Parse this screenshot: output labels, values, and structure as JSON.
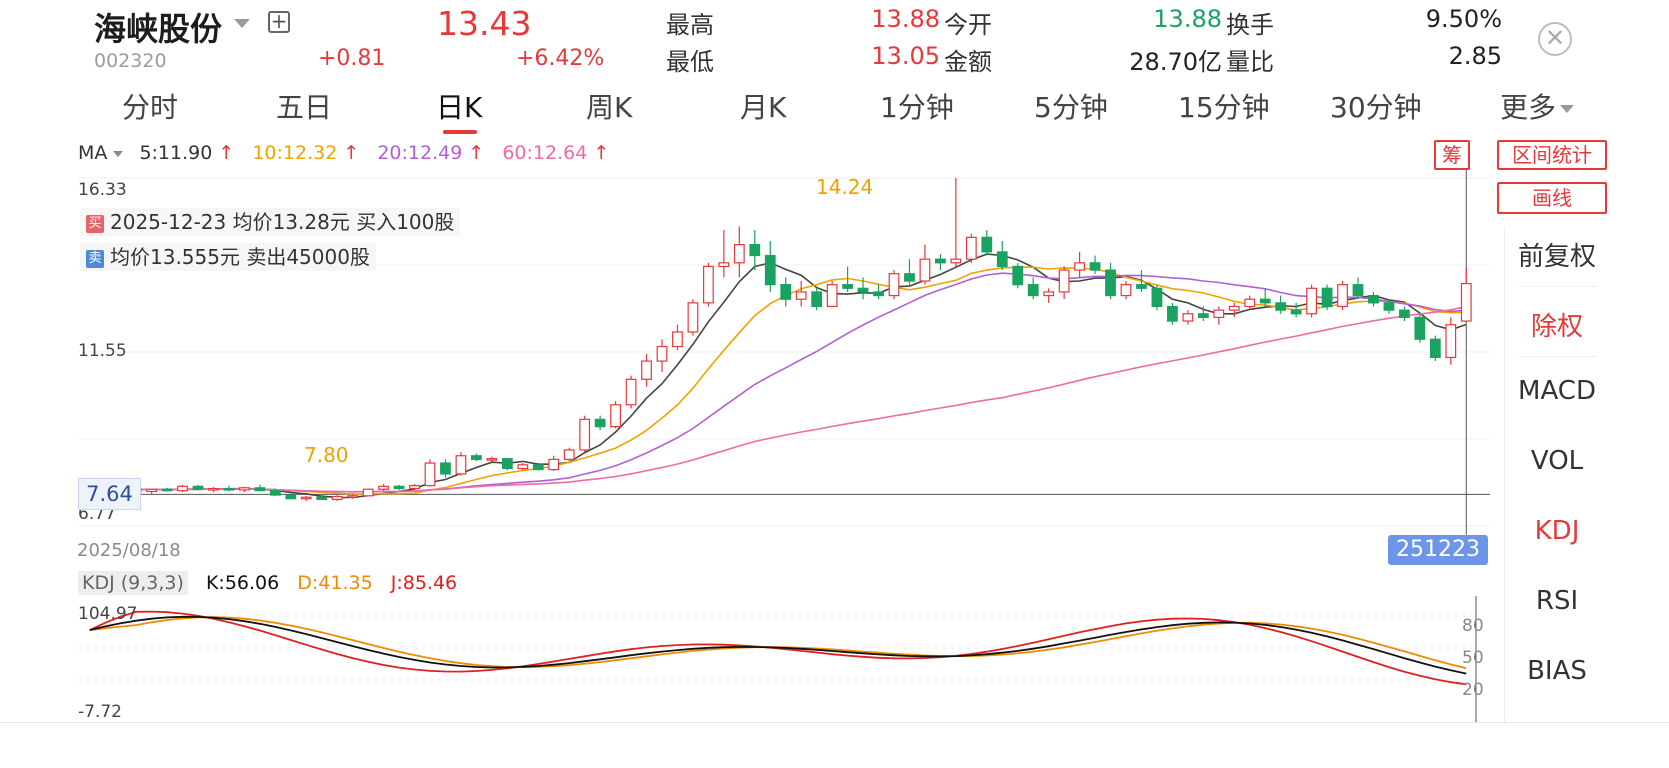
{
  "header": {
    "name": "海峡股份",
    "code": "002320",
    "price": "13.43",
    "change": "+0.81",
    "change_pct": "+6.42%",
    "quote": [
      {
        "label": "最高",
        "value": "13.88",
        "color": "#e8383a"
      },
      {
        "label": "今开",
        "value": "13.88",
        "color": "#1aa260"
      },
      {
        "label": "换手",
        "value": "9.50%",
        "color": "#222222"
      },
      {
        "label": "最低",
        "value": "13.05",
        "color": "#e8383a"
      },
      {
        "label": "金额",
        "value": "28.70亿",
        "color": "#222222"
      },
      {
        "label": "量比",
        "value": "2.85",
        "color": "#222222"
      }
    ]
  },
  "tabs": [
    "分时",
    "五日",
    "日K",
    "周K",
    "月K",
    "1分钟",
    "5分钟",
    "15分钟",
    "30分钟",
    "更多"
  ],
  "active_tab": "日K",
  "ma": {
    "label": "MA",
    "items": [
      {
        "text": "5:11.90",
        "color": "#333333"
      },
      {
        "text": "10:12.32",
        "color": "#f2a200"
      },
      {
        "text": "20:12.49",
        "color": "#b25fd6"
      },
      {
        "text": "60:12.64",
        "color": "#f06aa8"
      }
    ],
    "arrow": "↑",
    "arrow_color": "#e8383a"
  },
  "right_buttons": {
    "chips": "筹",
    "range_stats": "区间统计",
    "draw": "画线"
  },
  "side_panel": [
    {
      "label": "前复权",
      "active": false
    },
    {
      "label": "除权",
      "active": true
    },
    {
      "label": "MACD",
      "active": false
    },
    {
      "label": "VOL",
      "active": false
    },
    {
      "label": "KDJ",
      "active": true
    },
    {
      "label": "RSI",
      "active": false
    },
    {
      "label": "BIAS",
      "active": false
    }
  ],
  "trades": {
    "buy_tag": "买",
    "sell_tag": "卖",
    "buy_text": "2025-12-23 均价13.28元 买入100股",
    "sell_text": "均价13.555元 卖出45000股"
  },
  "axis": {
    "high": "16.33",
    "mid": "11.55",
    "low": "6.77",
    "current": "7.64"
  },
  "annotations": {
    "max": "14.24",
    "min": "7.80"
  },
  "dates": {
    "start": "2025/08/18",
    "cursor": "251223"
  },
  "kdj": {
    "name": "KDJ (9,3,3)",
    "k": "K:56.06",
    "d": "D:41.35",
    "j": "J:85.46",
    "top": "104.97",
    "bottom": "-7.72",
    "levels": [
      "80",
      "50",
      "20"
    ]
  },
  "colors": {
    "up": "#e8383a",
    "down": "#1aa260",
    "ma5": "#444444",
    "ma10": "#f2a200",
    "ma20": "#b25fd6",
    "ma60": "#f06aa8",
    "k": "#111111",
    "d": "#f08a00",
    "j": "#e02020"
  },
  "chart_data": {
    "type": "candlestick",
    "ylim": [
      6.77,
      16.33
    ],
    "candles": [
      [
        7.7,
        7.8,
        7.62,
        7.75
      ],
      [
        7.75,
        7.85,
        7.7,
        7.82
      ],
      [
        7.82,
        7.88,
        7.75,
        7.8
      ],
      [
        7.8,
        7.84,
        7.7,
        7.72
      ],
      [
        7.72,
        7.8,
        7.65,
        7.78
      ],
      [
        7.78,
        7.82,
        7.72,
        7.74
      ],
      [
        7.74,
        7.9,
        7.7,
        7.86
      ],
      [
        7.86,
        7.9,
        7.75,
        7.78
      ],
      [
        7.78,
        7.84,
        7.7,
        7.8
      ],
      [
        7.8,
        7.88,
        7.72,
        7.76
      ],
      [
        7.76,
        7.85,
        7.7,
        7.82
      ],
      [
        7.82,
        7.9,
        7.76,
        7.74
      ],
      [
        7.74,
        7.8,
        7.6,
        7.62
      ],
      [
        7.62,
        7.66,
        7.5,
        7.52
      ],
      [
        7.52,
        7.6,
        7.46,
        7.56
      ],
      [
        7.56,
        7.62,
        7.48,
        7.5
      ],
      [
        7.5,
        7.62,
        7.46,
        7.58
      ],
      [
        7.58,
        7.66,
        7.52,
        7.6
      ],
      [
        7.6,
        7.8,
        7.58,
        7.78
      ],
      [
        7.78,
        7.92,
        7.74,
        7.86
      ],
      [
        7.86,
        7.9,
        7.76,
        7.8
      ],
      [
        7.8,
        7.92,
        7.76,
        7.88
      ],
      [
        7.88,
        8.6,
        7.85,
        8.5
      ],
      [
        8.5,
        8.6,
        8.1,
        8.2
      ],
      [
        8.2,
        8.8,
        8.15,
        8.7
      ],
      [
        8.7,
        8.76,
        8.55,
        8.6
      ],
      [
        8.6,
        8.68,
        8.54,
        8.62
      ],
      [
        8.62,
        8.64,
        8.3,
        8.35
      ],
      [
        8.35,
        8.5,
        8.3,
        8.45
      ],
      [
        8.45,
        8.5,
        8.3,
        8.32
      ],
      [
        8.32,
        8.7,
        8.28,
        8.6
      ],
      [
        8.6,
        8.92,
        8.55,
        8.86
      ],
      [
        8.86,
        9.8,
        8.8,
        9.7
      ],
      [
        9.7,
        9.8,
        9.4,
        9.5
      ],
      [
        9.5,
        10.2,
        9.45,
        10.1
      ],
      [
        10.1,
        10.9,
        10.0,
        10.8
      ],
      [
        10.8,
        11.5,
        10.6,
        11.3
      ],
      [
        11.3,
        11.9,
        11.0,
        11.7
      ],
      [
        11.7,
        12.3,
        11.6,
        12.1
      ],
      [
        12.1,
        13.0,
        12.0,
        12.9
      ],
      [
        12.9,
        14.0,
        12.8,
        13.9
      ],
      [
        13.9,
        14.9,
        13.6,
        14.0
      ],
      [
        14.0,
        15.0,
        13.6,
        14.5
      ],
      [
        14.5,
        14.9,
        13.8,
        14.2
      ],
      [
        14.2,
        14.6,
        13.2,
        13.4
      ],
      [
        13.4,
        13.6,
        12.8,
        13.0
      ],
      [
        13.0,
        13.5,
        12.8,
        13.2
      ],
      [
        13.2,
        13.3,
        12.7,
        12.8
      ],
      [
        12.8,
        13.5,
        12.8,
        13.4
      ],
      [
        13.4,
        13.9,
        13.2,
        13.3
      ],
      [
        13.3,
        13.6,
        13.0,
        13.2
      ],
      [
        13.2,
        13.4,
        13.0,
        13.1
      ],
      [
        13.1,
        13.8,
        13.0,
        13.7
      ],
      [
        13.7,
        14.1,
        13.4,
        13.5
      ],
      [
        13.5,
        14.5,
        13.4,
        14.1
      ],
      [
        14.1,
        14.24,
        13.8,
        14.0
      ],
      [
        14.0,
        16.33,
        13.9,
        14.1
      ],
      [
        14.1,
        14.8,
        14.0,
        14.7
      ],
      [
        14.7,
        14.9,
        14.2,
        14.3
      ],
      [
        14.3,
        14.6,
        13.8,
        13.9
      ],
      [
        13.9,
        14.0,
        13.3,
        13.4
      ],
      [
        13.4,
        13.6,
        13.0,
        13.1
      ],
      [
        13.1,
        13.3,
        12.9,
        13.2
      ],
      [
        13.2,
        13.9,
        13.0,
        13.8
      ],
      [
        13.8,
        14.3,
        13.6,
        14.0
      ],
      [
        14.0,
        14.2,
        13.7,
        13.8
      ],
      [
        13.8,
        14.0,
        13.0,
        13.1
      ],
      [
        13.1,
        13.5,
        13.0,
        13.4
      ],
      [
        13.4,
        13.8,
        13.2,
        13.3
      ],
      [
        13.3,
        13.4,
        12.7,
        12.8
      ],
      [
        12.8,
        12.9,
        12.3,
        12.4
      ],
      [
        12.4,
        12.7,
        12.3,
        12.6
      ],
      [
        12.6,
        12.8,
        12.4,
        12.5
      ],
      [
        12.5,
        12.8,
        12.3,
        12.7
      ],
      [
        12.7,
        12.9,
        12.5,
        12.8
      ],
      [
        12.8,
        13.1,
        12.7,
        13.0
      ],
      [
        13.0,
        13.3,
        12.8,
        12.9
      ],
      [
        12.9,
        13.1,
        12.6,
        12.7
      ],
      [
        12.7,
        12.9,
        12.5,
        12.6
      ],
      [
        12.6,
        13.4,
        12.5,
        13.3
      ],
      [
        13.3,
        13.4,
        12.7,
        12.8
      ],
      [
        12.8,
        13.5,
        12.7,
        13.4
      ],
      [
        13.4,
        13.6,
        13.0,
        13.1
      ],
      [
        13.1,
        13.2,
        12.8,
        12.9
      ],
      [
        12.9,
        13.0,
        12.6,
        12.7
      ],
      [
        12.7,
        12.8,
        12.4,
        12.5
      ],
      [
        12.5,
        12.6,
        11.8,
        11.9
      ],
      [
        11.9,
        12.0,
        11.3,
        11.4
      ],
      [
        11.4,
        12.5,
        11.2,
        12.3
      ],
      [
        12.4,
        13.88,
        12.4,
        13.43
      ]
    ]
  }
}
